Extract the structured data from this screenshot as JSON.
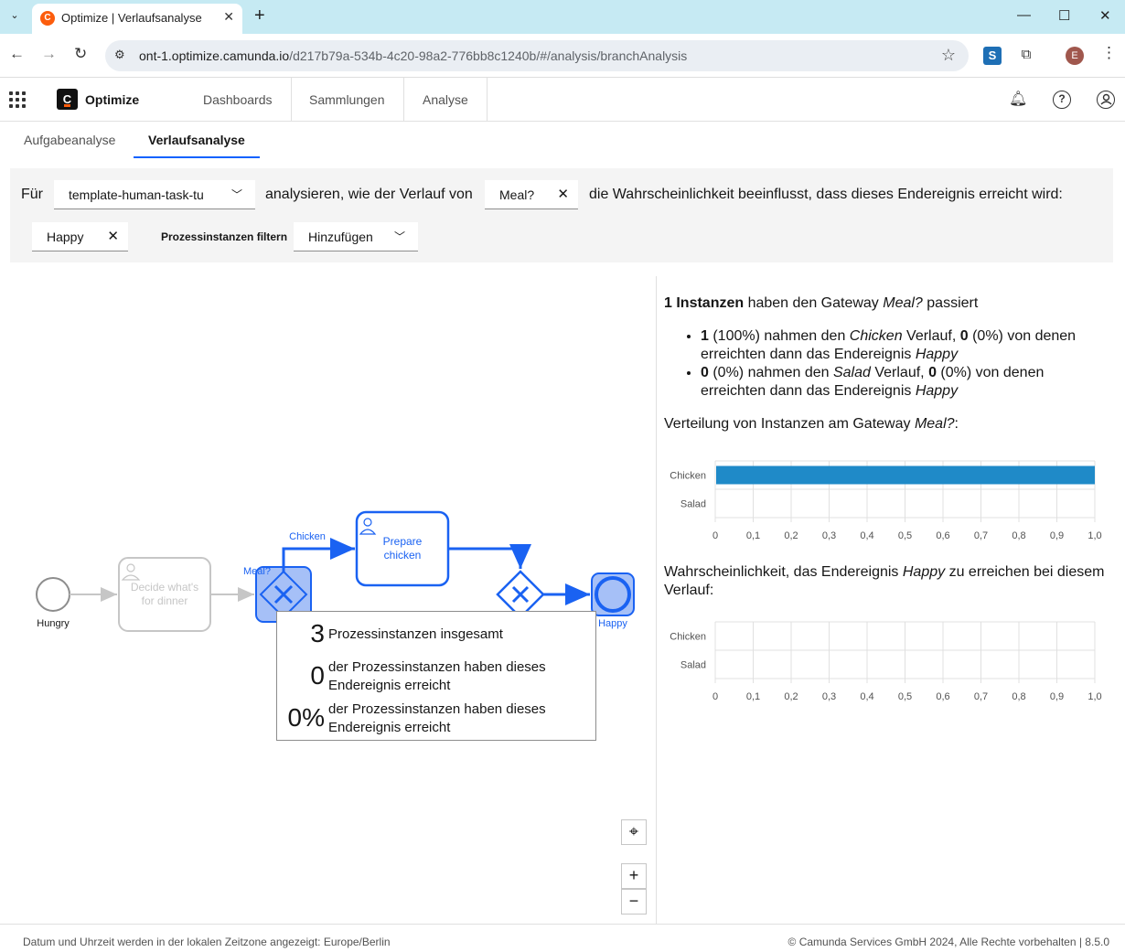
{
  "browser": {
    "tab_title": "Optimize | Verlaufsanalyse",
    "url_host": "ont-1.optimize.camunda.io",
    "url_path": "/d217b79a-534b-4c20-98a2-776bb8c1240b/#/analysis/branchAnalysis",
    "profile_initial": "E",
    "extension_label": "S"
  },
  "app": {
    "logo_letter": "C",
    "brand": "Optimize",
    "nav": [
      "Dashboards",
      "Sammlungen",
      "Analyse"
    ]
  },
  "subtabs": [
    {
      "label": "Aufgabeanalyse",
      "active": false
    },
    {
      "label": "Verlaufsanalyse",
      "active": true
    }
  ],
  "controls": {
    "for_label": "Für",
    "process_value": "template-human-task-tu",
    "analyze_label": "analysieren, wie der Verlauf von",
    "gateway_value": "Meal?",
    "probability_label": "die Wahrscheinlichkeit beeinflusst, dass dieses Endereignis erreicht wird:",
    "end_event_value": "Happy",
    "filter_label": "Prozessinstanzen filtern",
    "filter_value": "Hinzufügen"
  },
  "diagram": {
    "start_label": "Hungry",
    "task1_label": [
      "Decide what's",
      "for dinner"
    ],
    "gateway_label": "Meal?",
    "flow_label": "Chicken",
    "task2_label": [
      "Prepare",
      "chicken"
    ],
    "end_label": "Happy",
    "colors": {
      "active": "#1a62f2",
      "inactive": "#c6c6c6",
      "highlight": "#a6c0f7"
    }
  },
  "tooltip": {
    "total_value": "3",
    "total_label": "Prozessinstanzen insgesamt",
    "reached_value": "0",
    "reached_label": "der Prozessinstanzen haben dieses Endereignis erreicht",
    "percent_value": "0%",
    "percent_label": "der Prozessinstanzen haben dieses Endereignis erreicht"
  },
  "summary": {
    "instances_bold": "1 Instanzen",
    "instances_text": " haben den Gateway ",
    "gateway_italic": "Meal?",
    "passed": " passiert",
    "items": [
      {
        "count": "1",
        "pct": " (100%) nahmen den ",
        "branch": "Chicken",
        "mid": " Verlauf, ",
        "reached": "0",
        "tail": " (0%) von denen erreichten dann das Endereignis ",
        "end": "Happy"
      },
      {
        "count": "0",
        "pct": " (0%) nahmen den ",
        "branch": "Salad",
        "mid": " Verlauf, ",
        "reached": "0",
        "tail": " (0%) von denen erreichten dann das Endereignis ",
        "end": "Happy"
      }
    ],
    "dist_title_pre": "Verteilung von Instanzen am Gateway ",
    "dist_title_gw": "Meal?",
    "dist_title_post": ":",
    "prob_title_pre": "Wahrscheinlichkeit, das Endereignis ",
    "prob_title_end": "Happy",
    "prob_title_post": " zu erreichen bei diesem Verlauf:"
  },
  "chart_data": [
    {
      "type": "bar",
      "orientation": "horizontal",
      "categories": [
        "Chicken",
        "Salad"
      ],
      "values": [
        1.0,
        0.0
      ],
      "xlim": [
        0,
        1
      ],
      "ticks": [
        "0",
        "0,1",
        "0,2",
        "0,3",
        "0,4",
        "0,5",
        "0,6",
        "0,7",
        "0,8",
        "0,9",
        "1,0"
      ],
      "bar_color": "#1f8ac8",
      "grid": true
    },
    {
      "type": "bar",
      "orientation": "horizontal",
      "categories": [
        "Chicken",
        "Salad"
      ],
      "values": [
        0,
        0
      ],
      "xlim": [
        0,
        1
      ],
      "ticks": [
        "0",
        "0,1",
        "0,2",
        "0,3",
        "0,4",
        "0,5",
        "0,6",
        "0,7",
        "0,8",
        "0,9",
        "1,0"
      ],
      "bar_color": "#1f8ac8",
      "grid": true
    }
  ],
  "footer": {
    "left": "Datum und Uhrzeit werden in der lokalen Zeitzone angezeigt: Europe/Berlin",
    "right": "© Camunda Services GmbH 2024, Alle Rechte vorbehalten | 8.5.0"
  }
}
